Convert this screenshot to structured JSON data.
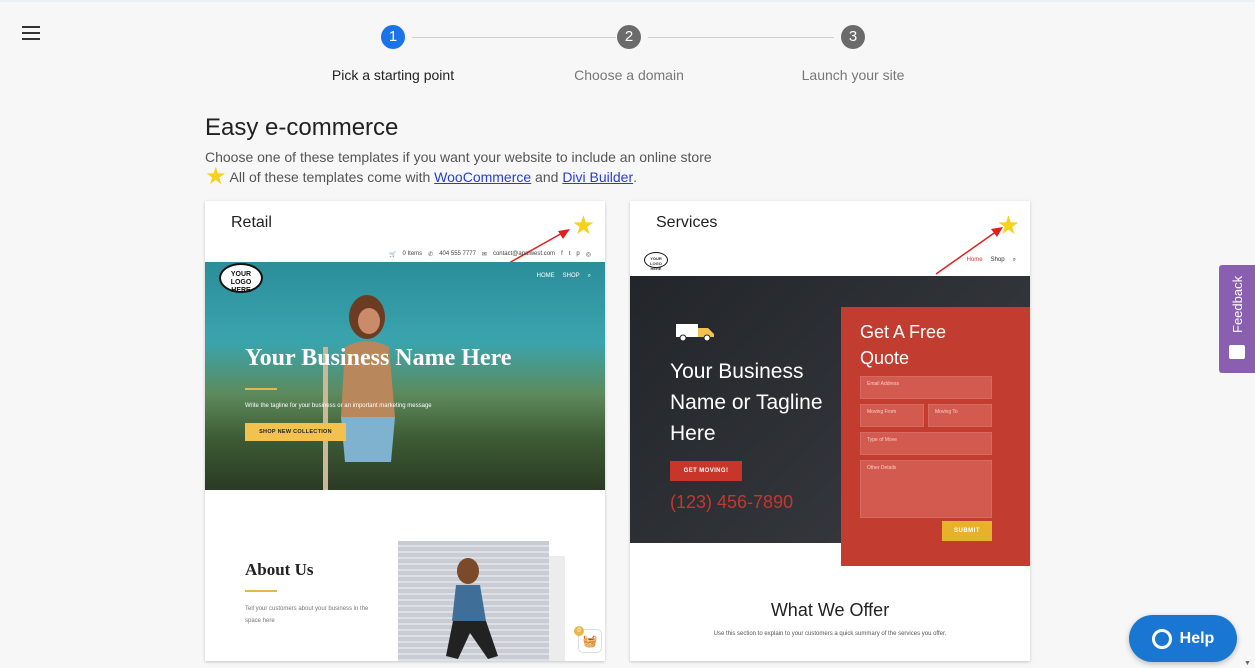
{
  "stepper": {
    "steps": [
      {
        "num": "1",
        "label": "Pick a starting point",
        "active": true
      },
      {
        "num": "2",
        "label": "Choose a domain",
        "active": false
      },
      {
        "num": "3",
        "label": "Launch your site",
        "active": false
      }
    ]
  },
  "colors": {
    "active_step": "#1a73e8",
    "inactive_step": "#6b6b6b",
    "star": "#f7d21c",
    "help": "#1976d2",
    "feedback": "#8b5fb0"
  },
  "section": {
    "title": "Easy e-commerce",
    "description": "Choose one of these templates if you want your website to include an online store",
    "note_prefix": "All of these templates come with ",
    "woocommerce": "WooCommerce",
    "and": " and ",
    "divi": "Divi Builder",
    "period": "."
  },
  "cards": {
    "retail": {
      "title": "Retail",
      "topbar": {
        "items": "0 Items",
        "phone": "404 555 7777",
        "email": "contact@apalwest.com"
      },
      "logo": "YOUR LOGO HERE",
      "nav": [
        "HOME",
        "SHOP"
      ],
      "hero_title": "Your Business Name Here",
      "tagline": "Write the tagline for your business or an important marketing message",
      "cta": "SHOP NEW COLLECTION",
      "about_title": "About Us",
      "about_text": "Tell your customers about your business in the space here",
      "cart_count": "0"
    },
    "services": {
      "title": "Services",
      "logo": "YOUR LOGO HERE",
      "nav": [
        "Home",
        "Shop"
      ],
      "hero_title": "Your Business Name or Tagline Here",
      "cta": "GET MOVING!",
      "phone": "(123) 456-7890",
      "form_title": "Get A Free Quote",
      "fields": {
        "email": "Email Address",
        "from": "Moving From",
        "to": "Moving To",
        "type": "Type of Move",
        "other": "Other Details"
      },
      "submit": "SUBMIT",
      "offer_title": "What We Offer",
      "offer_text": "Use this section to explain to your customers a quick summary of the services you offer."
    }
  },
  "feedback": "Feedback",
  "help": "Help"
}
